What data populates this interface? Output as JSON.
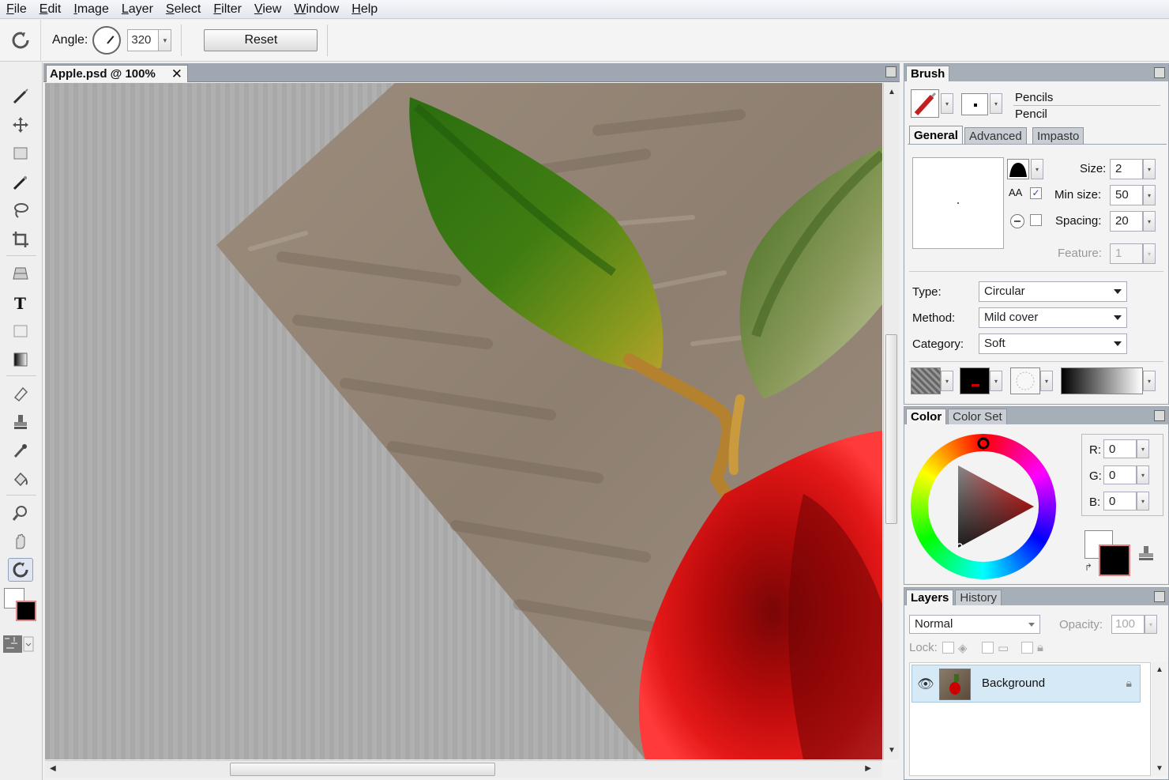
{
  "menu": [
    "File",
    "Edit",
    "Image",
    "Layer",
    "Select",
    "Filter",
    "View",
    "Window",
    "Help"
  ],
  "options": {
    "angle_label": "Angle:",
    "angle_value": "320",
    "reset_label": "Reset"
  },
  "document": {
    "tab_title": "Apple.psd @ 100%",
    "close_glyph": "✕"
  },
  "brush_panel": {
    "tab": "Brush",
    "category": "Pencils",
    "variant": "Pencil",
    "tabs": [
      "General",
      "Advanced",
      "Impasto"
    ],
    "size_label": "Size:",
    "size_value": "2",
    "min_size_label": "Min size:",
    "min_size_value": "50",
    "spacing_label": "Spacing:",
    "spacing_value": "20",
    "feature_label": "Feature:",
    "feature_value": "1",
    "aa_label": "AA",
    "min_size_checked": "✓",
    "type_label": "Type:",
    "type_value": "Circular",
    "method_label": "Method:",
    "method_value": "Mild cover",
    "category_label": "Category:",
    "category_value": "Soft"
  },
  "color_panel": {
    "tabs": [
      "Color",
      "Color Set"
    ],
    "r_label": "R:",
    "r_value": "0",
    "g_label": "G:",
    "g_value": "0",
    "b_label": "B:",
    "b_value": "0",
    "foreground": "#000000",
    "background": "#ffffff"
  },
  "layers_panel": {
    "tabs": [
      "Layers",
      "History"
    ],
    "blend_mode": "Normal",
    "opacity_label": "Opacity:",
    "opacity_value": "100",
    "lock_label": "Lock:",
    "layers": [
      {
        "name": "Background",
        "visible": true,
        "locked": true
      }
    ]
  },
  "colors": {
    "accent_selection": "#d6e9f7",
    "panel_header": "#a6aeb8",
    "apple_red": "#e01010",
    "leaf_green": "#3f7a16"
  }
}
